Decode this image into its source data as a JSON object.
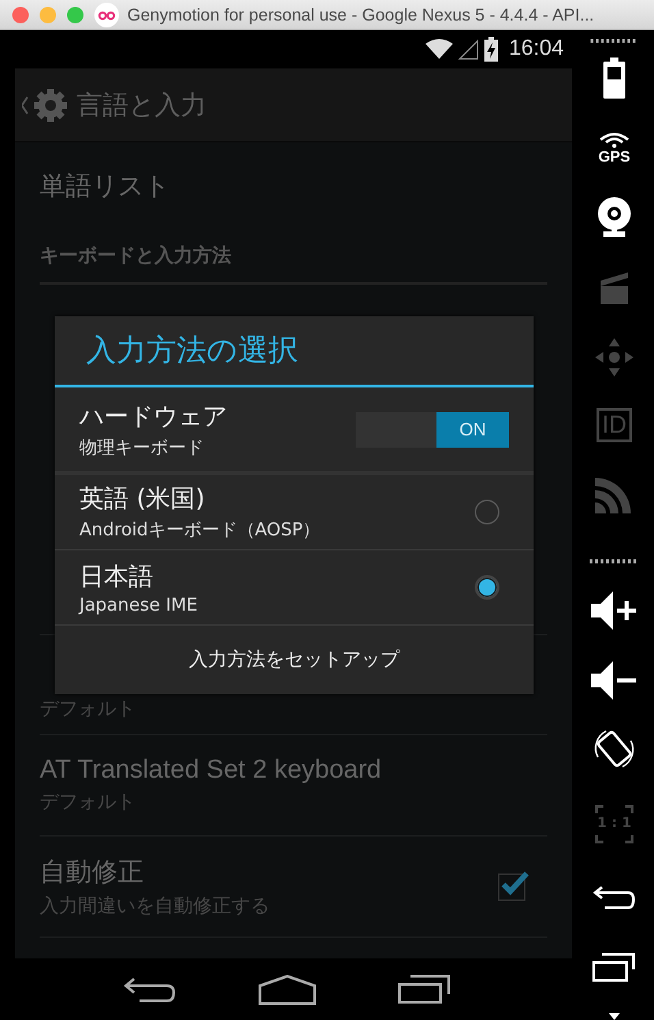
{
  "window": {
    "title": "Genymotion for personal use - Google Nexus 5 - 4.4.4 - API..."
  },
  "status_bar": {
    "time": "16:04"
  },
  "action_bar": {
    "title": "言語と入力"
  },
  "settings": [
    {
      "kind": "item",
      "title": "単語リスト"
    },
    {
      "kind": "header",
      "title": "キーボードと入力方法"
    },
    {
      "kind": "hidden"
    },
    {
      "kind": "item",
      "subtitle": "デフォルト"
    },
    {
      "kind": "item",
      "title": "AT Translated Set 2 keyboard",
      "subtitle": "デフォルト"
    },
    {
      "kind": "check",
      "title": "自動修正",
      "subtitle": "入力間違いを自動修正する",
      "checked": true
    }
  ],
  "dialog": {
    "title": "入力方法の選択",
    "options": [
      {
        "kind": "switch",
        "title": "ハードウェア",
        "subtitle": "物理キーボード",
        "on": true,
        "switch_label": "ON"
      },
      {
        "kind": "radio",
        "title": "英語 (米国)",
        "subtitle": "Androidキーボード（AOSP）",
        "selected": false
      },
      {
        "kind": "radio",
        "title": "日本語",
        "subtitle": "Japanese IME",
        "selected": true
      }
    ],
    "button": "入力方法をセットアップ"
  },
  "sidebar": [
    {
      "kind": "battery",
      "enabled": true
    },
    {
      "kind": "gps",
      "label": "GPS",
      "enabled": true
    },
    {
      "kind": "camera",
      "enabled": true
    },
    {
      "kind": "clapper",
      "enabled": false
    },
    {
      "kind": "dpad",
      "enabled": false
    },
    {
      "kind": "id",
      "label": "ID",
      "enabled": false
    },
    {
      "kind": "signal",
      "enabled": false
    },
    {
      "kind": "grip"
    },
    {
      "kind": "volup",
      "enabled": true
    },
    {
      "kind": "voldown",
      "enabled": true
    },
    {
      "kind": "rotate",
      "enabled": true
    },
    {
      "kind": "scale",
      "label": "1 : 1",
      "enabled": false
    },
    {
      "kind": "back",
      "enabled": true
    },
    {
      "kind": "recents",
      "enabled": true
    }
  ]
}
